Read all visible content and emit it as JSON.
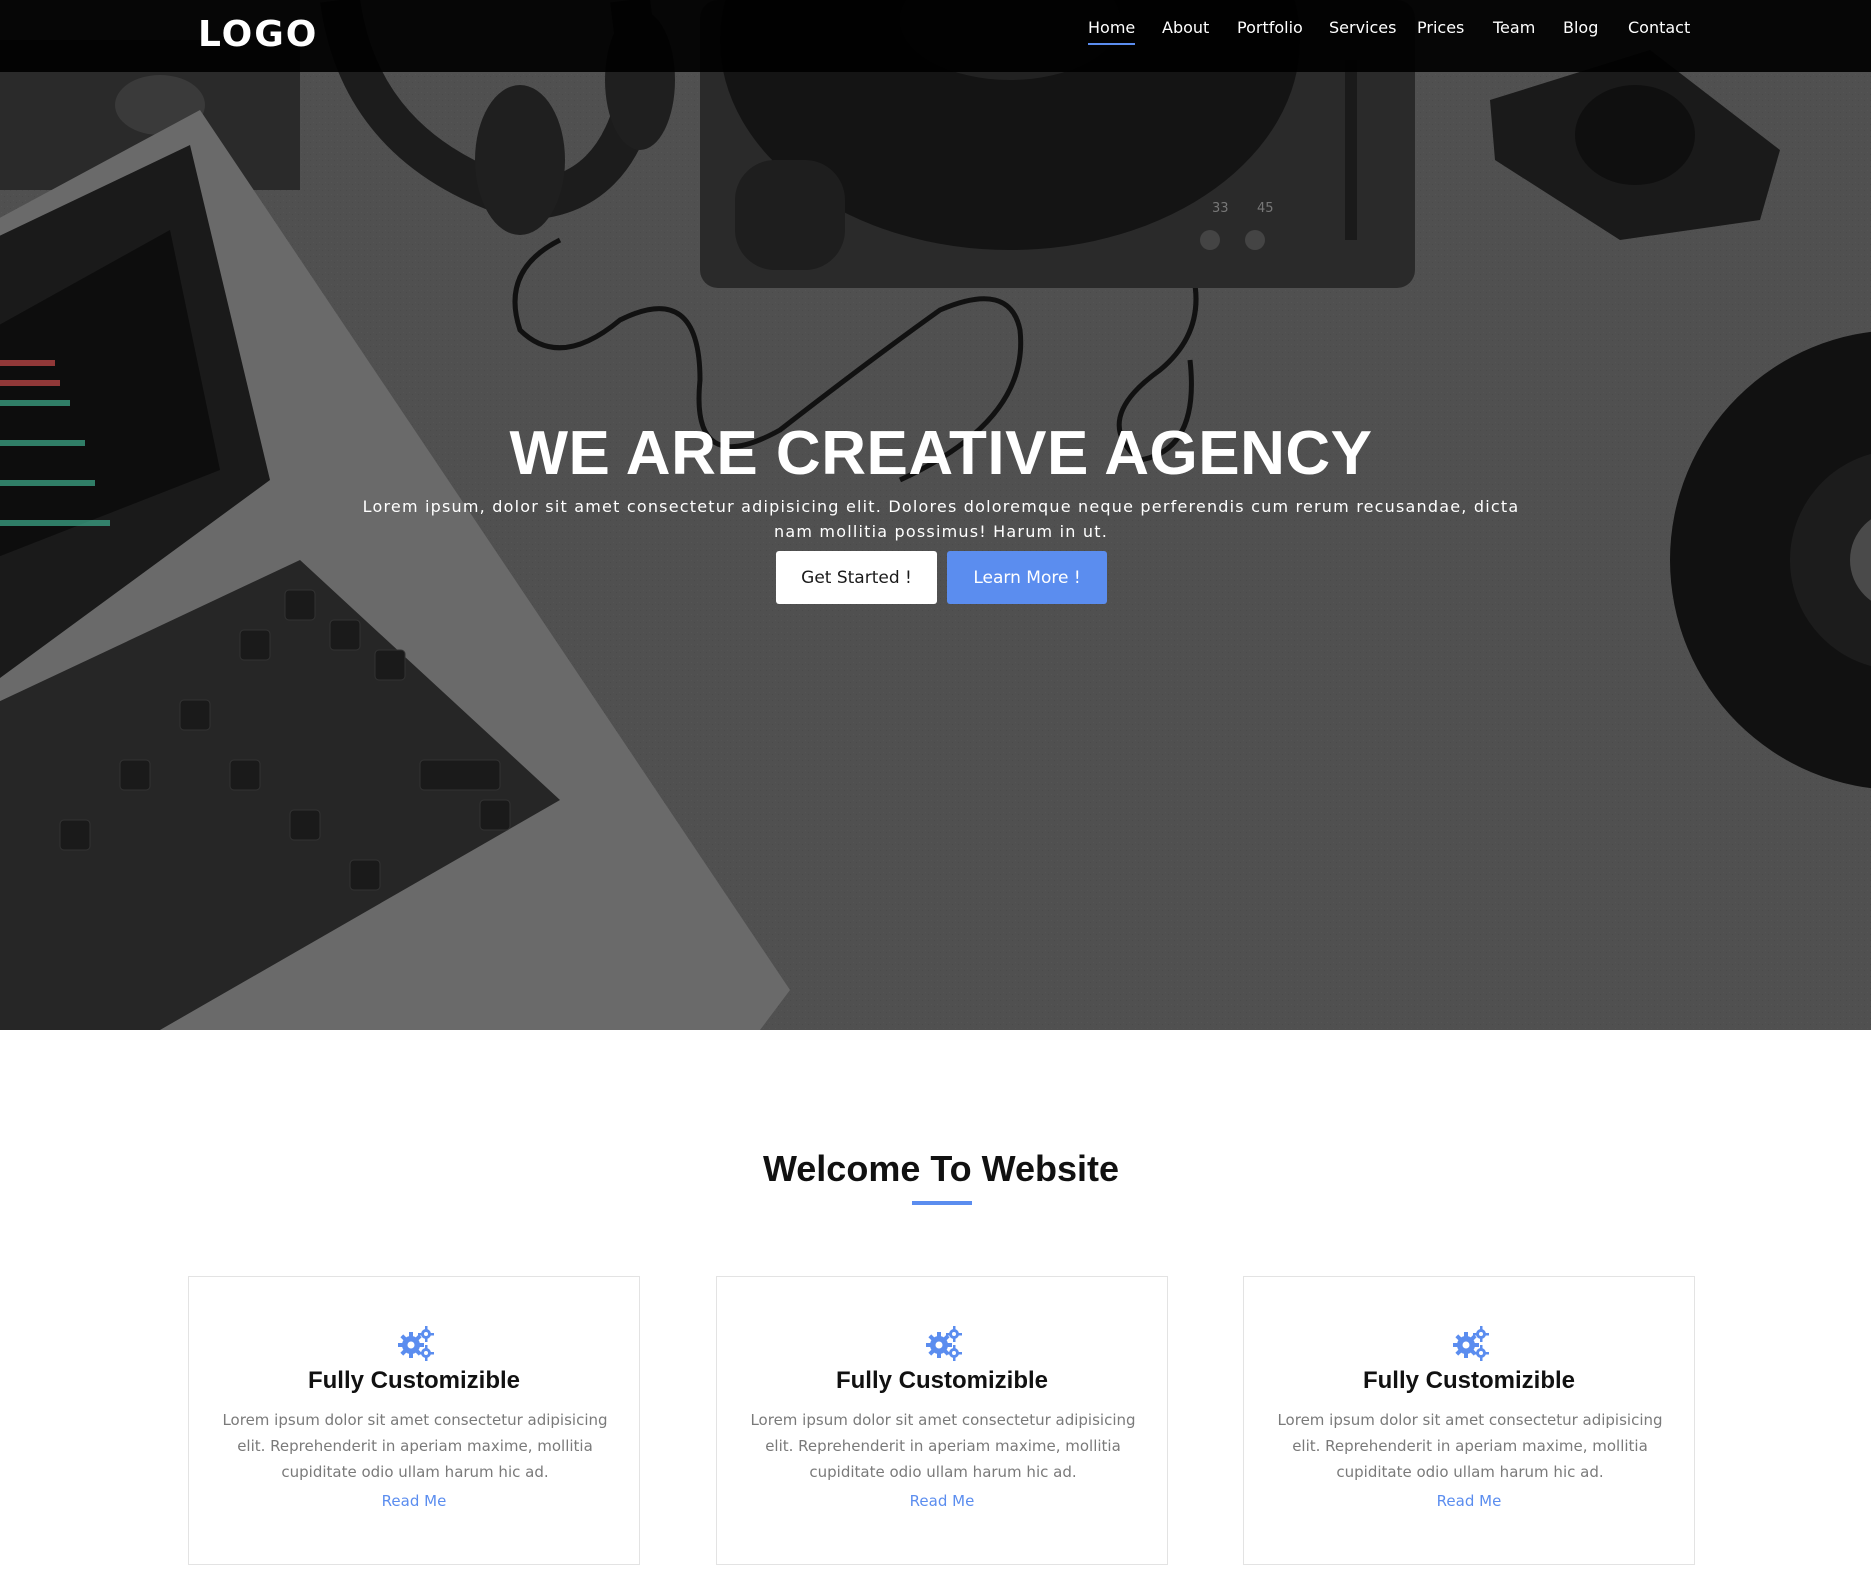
{
  "colors": {
    "accent": "#5b8def",
    "navbar_bg": "#000000",
    "hero_overlay": "#4a4a4a",
    "text_dark": "#111111",
    "text_muted": "#7a7a7a"
  },
  "navbar": {
    "logo": "LOGO",
    "items": [
      {
        "label": "Home",
        "active": true
      },
      {
        "label": "About",
        "active": false
      },
      {
        "label": "Portfolio",
        "active": false
      },
      {
        "label": "Services",
        "active": false
      },
      {
        "label": "Prices",
        "active": false
      },
      {
        "label": "Team",
        "active": false
      },
      {
        "label": "Blog",
        "active": false
      },
      {
        "label": "Contact",
        "active": false
      }
    ]
  },
  "hero": {
    "title": "WE ARE CREATIVE AGENCY",
    "subtitle": "Lorem ipsum, dolor sit amet consectetur adipisicing elit. Dolores doloremque neque perferendis cum rerum recusandae, dicta nam mollitia possimus! Harum in ut.",
    "primary_button": "Get Started !",
    "secondary_button": "Learn More !",
    "background_icon": "desk-photo-laptop-headphones-turntable"
  },
  "welcome": {
    "title": "Welcome To Website"
  },
  "features": [
    {
      "icon": "gears-icon",
      "title": "Fully Customizible",
      "text": "Lorem ipsum dolor sit amet consectetur adipisicing elit. Reprehenderit in aperiam maxime, mollitia cupiditate odio ullam harum hic ad.",
      "link": "Read Me"
    },
    {
      "icon": "gears-icon",
      "title": "Fully Customizible",
      "text": "Lorem ipsum dolor sit amet consectetur adipisicing elit. Reprehenderit in aperiam maxime, mollitia cupiditate odio ullam harum hic ad.",
      "link": "Read Me"
    },
    {
      "icon": "gears-icon",
      "title": "Fully Customizible",
      "text": "Lorem ipsum dolor sit amet consectetur adipisicing elit. Reprehenderit in aperiam maxime, mollitia cupiditate odio ullam harum hic ad.",
      "link": "Read Me"
    }
  ]
}
